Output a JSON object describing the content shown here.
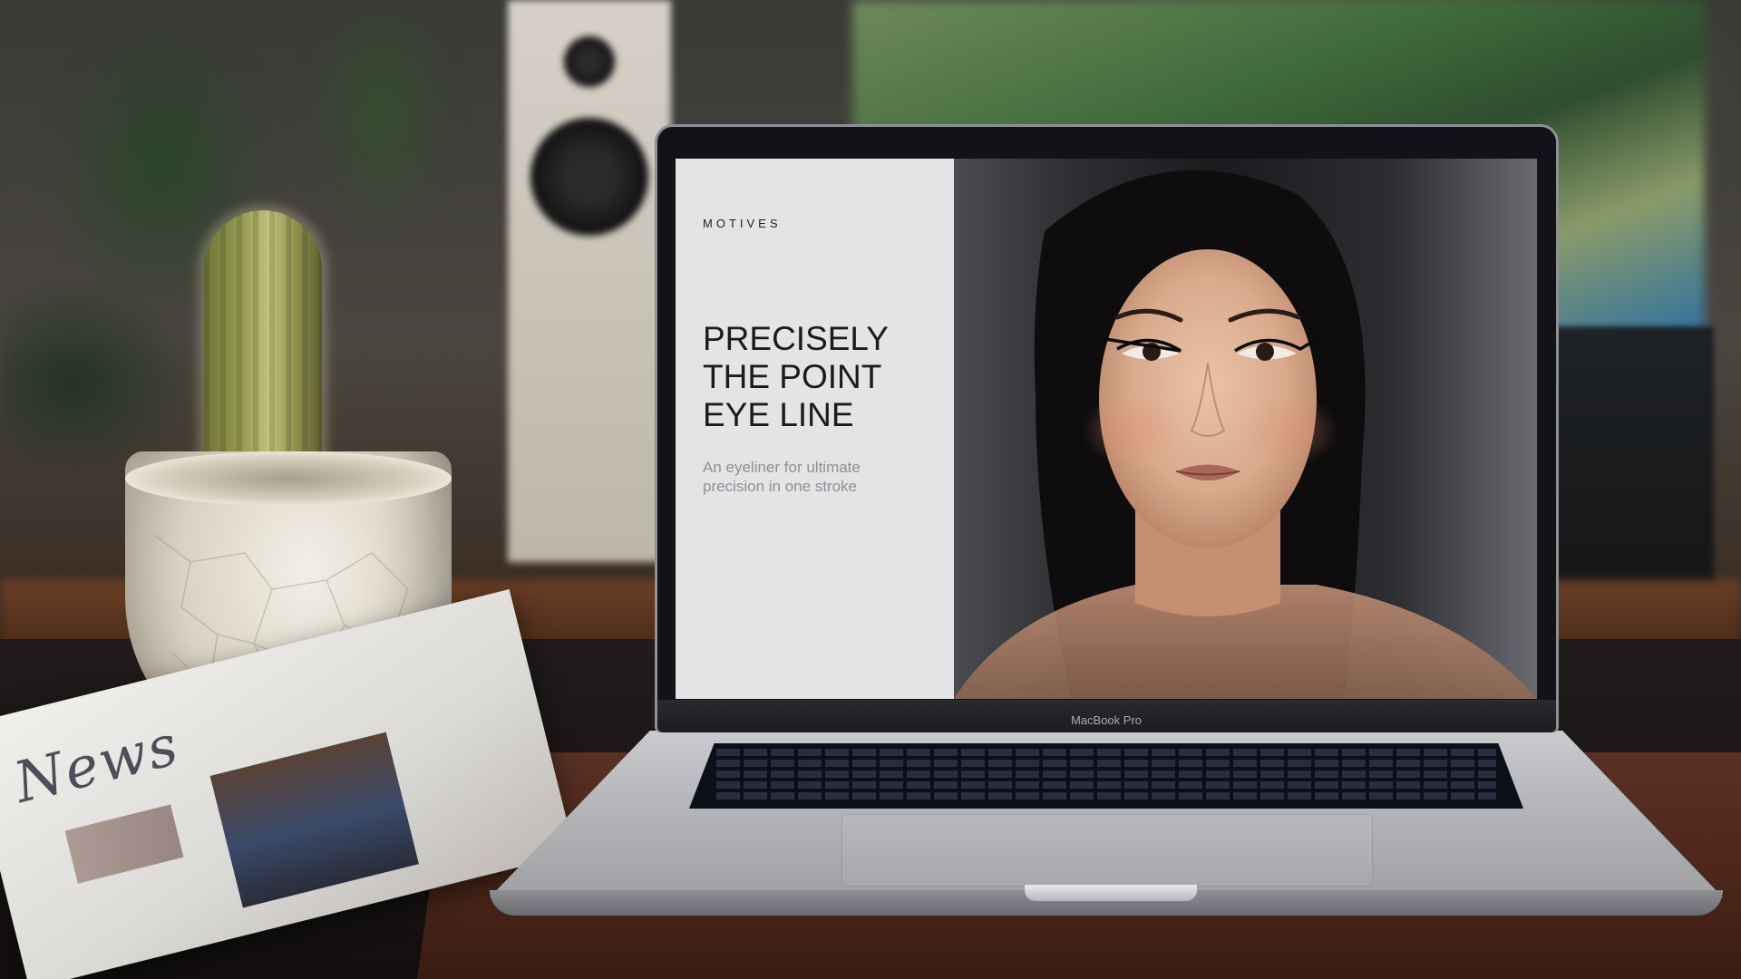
{
  "laptop": {
    "brand_label": "MacBook Pro"
  },
  "website": {
    "brand": "MOTIVES",
    "headline_lines": [
      "PRECISELY",
      "THE POINT",
      "EYE LINE"
    ],
    "subheadline": "An eyeliner for ultimate precision in one stroke",
    "hero_image_alt": "portrait of a woman with winged eyeliner"
  },
  "newspaper": {
    "masthead": "News"
  },
  "colors": {
    "panel_background": "#e3e4e6",
    "headline_text": "#1b1b1d",
    "subheadline_text": "#8f9094"
  }
}
